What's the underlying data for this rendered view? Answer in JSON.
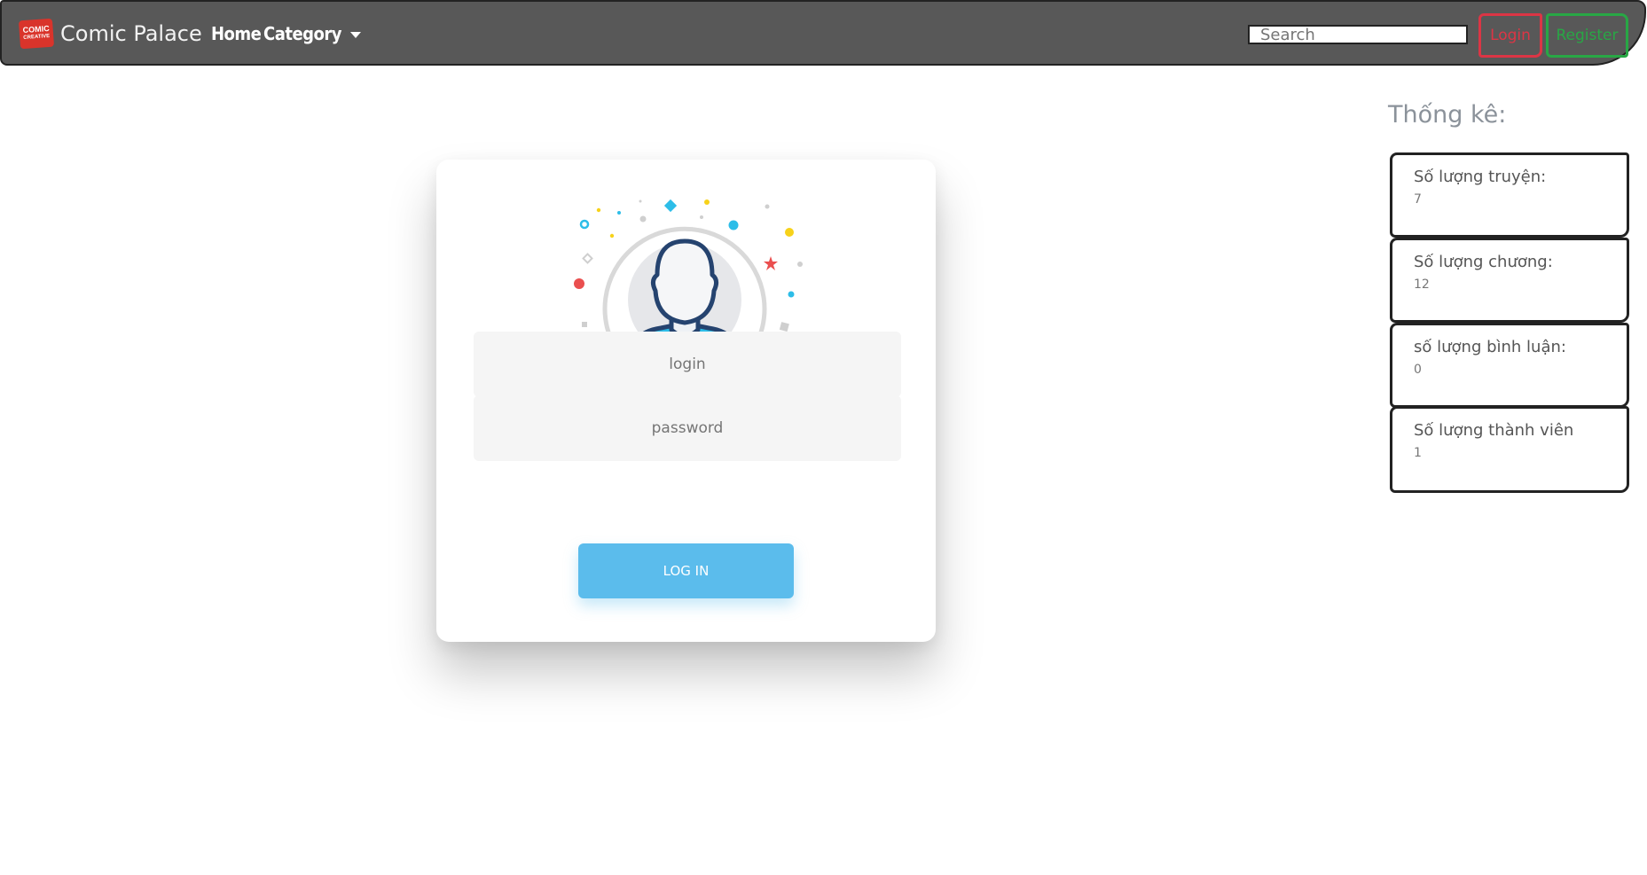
{
  "navbar": {
    "brand_logo_line1": "COMIC",
    "brand_logo_line2": "CREATIVE",
    "brand_name": "Comic Palace",
    "home": "Home",
    "category": "Category",
    "search_placeholder": "Search",
    "login": "Login",
    "register": "Register"
  },
  "login_form": {
    "login_placeholder": "login",
    "password_placeholder": "password",
    "submit_label": "LOG IN"
  },
  "stats": {
    "title": "Thống kê:",
    "items": [
      {
        "label": "Số lượng truyện:",
        "value": "7"
      },
      {
        "label": "Số lượng chương:",
        "value": "12"
      },
      {
        "label": "số lượng bình luận:",
        "value": "0"
      },
      {
        "label": "Số lượng thành viên",
        "value": "1"
      }
    ]
  },
  "colors": {
    "navbar_bg": "#585858",
    "login_accent": "#dc3545",
    "register_accent": "#28a745",
    "button_blue": "#5bbcec",
    "avatar_body": "#2dbde8",
    "avatar_outline": "#25436f"
  }
}
